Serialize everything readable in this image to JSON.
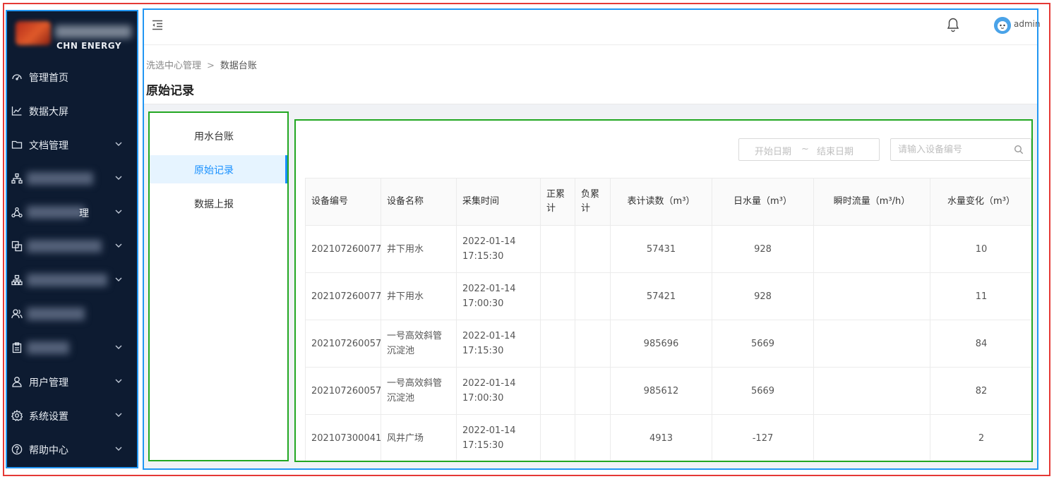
{
  "brand": {
    "name": "CHN ENERGY"
  },
  "sidebar": {
    "items": [
      {
        "icon": "dashboard-icon",
        "label": "管理首页",
        "chevron": false
      },
      {
        "icon": "line-chart-icon",
        "label": "数据大屏",
        "chevron": false
      },
      {
        "icon": "folder-icon",
        "label": "文档管理",
        "chevron": true
      },
      {
        "icon": "org-chart-icon",
        "label": "",
        "chevron": true
      },
      {
        "icon": "cluster-icon",
        "label": "理",
        "chevron": true
      },
      {
        "icon": "copy-icon",
        "label": "",
        "chevron": true
      },
      {
        "icon": "hierarchy-icon",
        "label": "",
        "chevron": true
      },
      {
        "icon": "team-icon",
        "label": "",
        "chevron": false
      },
      {
        "icon": "clipboard-icon",
        "label": "",
        "chevron": true
      },
      {
        "icon": "user-icon",
        "label": "用户管理",
        "chevron": true
      },
      {
        "icon": "gear-icon",
        "label": "系统设置",
        "chevron": true
      },
      {
        "icon": "help-icon",
        "label": "帮助中心",
        "chevron": true
      }
    ]
  },
  "topbar": {
    "username": "admin"
  },
  "breadcrumb": {
    "parent": "洗选中心管理",
    "separator": ">",
    "current": "数据台账"
  },
  "page": {
    "title": "原始记录"
  },
  "submenu": {
    "items": [
      {
        "label": "用水台账",
        "active": false
      },
      {
        "label": "原始记录",
        "active": true
      },
      {
        "label": "数据上报",
        "active": false
      }
    ]
  },
  "filters": {
    "start_placeholder": "开始日期",
    "tilde": "~",
    "end_placeholder": "结束日期",
    "search_placeholder": "请输入设备编号"
  },
  "table": {
    "headers": [
      "设备编号",
      "设备名称",
      "采集时间",
      "正累计",
      "负累计",
      "表计读数（m³）",
      "日水量（m³）",
      "瞬时流量（m³/h）",
      "水量变化（m³）"
    ],
    "rows": [
      {
        "device_no": "202107260077",
        "device_name": "井下用水",
        "date": "2022-01-14",
        "time": "17:15:30",
        "pos": "",
        "neg": "",
        "reading": "57431",
        "daily": "928",
        "flow": "",
        "change": "10"
      },
      {
        "device_no": "202107260077",
        "device_name": "井下用水",
        "date": "2022-01-14",
        "time": "17:00:30",
        "pos": "",
        "neg": "",
        "reading": "57421",
        "daily": "928",
        "flow": "",
        "change": "11"
      },
      {
        "device_no": "202107260057",
        "device_name": "一号高效斜管沉淀池",
        "date": "2022-01-14",
        "time": "17:15:30",
        "pos": "",
        "neg": "",
        "reading": "985696",
        "daily": "5669",
        "flow": "",
        "change": "84"
      },
      {
        "device_no": "202107260057",
        "device_name": "一号高效斜管沉淀池",
        "date": "2022-01-14",
        "time": "17:00:30",
        "pos": "",
        "neg": "",
        "reading": "985612",
        "daily": "5669",
        "flow": "",
        "change": "82"
      },
      {
        "device_no": "202107300041",
        "device_name": "风井广场",
        "date": "2022-01-14",
        "time": "17:15:30",
        "pos": "",
        "neg": "",
        "reading": "4913",
        "daily": "-127",
        "flow": "",
        "change": "2"
      }
    ]
  },
  "colors": {
    "sidebar_bg": "#0d1b31",
    "accent": "#1890ff",
    "frame_red": "#e53935",
    "frame_blue": "#2196f3",
    "frame_green": "#22a722"
  }
}
